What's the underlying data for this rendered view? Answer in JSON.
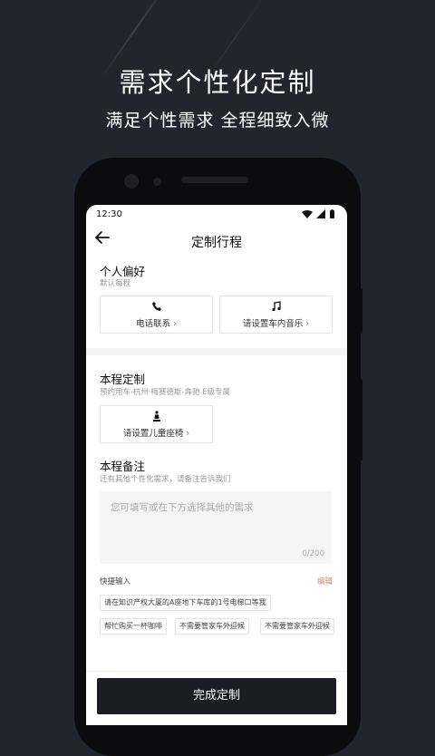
{
  "promo": {
    "title": "需求个性化定制",
    "subtitle": "满足个性需求 全程细致入微"
  },
  "status_bar": {
    "time": "12:30"
  },
  "nav": {
    "title": "定制行程"
  },
  "preferences": {
    "title": "个人偏好",
    "subtitle": "默认每程",
    "options": [
      {
        "label": "电话联系",
        "icon": "phone-icon"
      },
      {
        "label": "请设置车内音乐",
        "icon": "music-note-icon"
      }
    ]
  },
  "trip": {
    "title": "本程定制",
    "subtitle": "预约用车·杭州·梅赛德斯-奔驰 E级专属",
    "child_seat": {
      "label": "请设置儿童座椅",
      "icon": "child-seat-icon"
    }
  },
  "notes": {
    "title": "本程备注",
    "subtitle": "还有其他个性化需求，请备注告诉我们",
    "placeholder": "您可填写或在下方选择其他的需求",
    "counter": "0/200"
  },
  "quick_input": {
    "label": "快捷输入",
    "edit": "编辑",
    "chips": [
      "请在知识产权大厦的A座地下车库的1号电梯口等我",
      "帮忙购买一杯咖啡",
      "不需要管家车外迎候",
      "不需要管家车外迎候"
    ]
  },
  "actions": {
    "done": "完成定制"
  },
  "colors": {
    "background": "#23252e",
    "button": "#1b1c24",
    "accent": "#d4895b"
  }
}
